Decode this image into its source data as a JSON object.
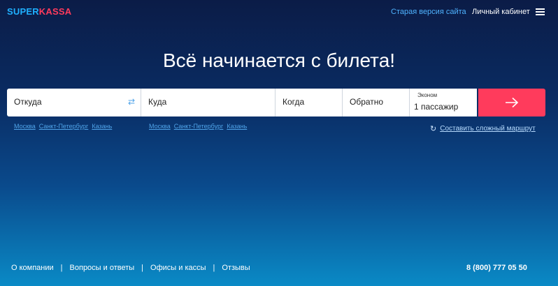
{
  "header": {
    "logo_part1": "SUPER",
    "logo_part2": "KASSA",
    "old_site_link": "Старая версия сайта",
    "cabinet_link": "Личный кабинет",
    "menu_icon": "hamburger-menu-icon"
  },
  "headline": "Всё начинается с билета!",
  "search": {
    "from_placeholder": "Откуда",
    "to_placeholder": "Куда",
    "when_placeholder": "Когда",
    "back_placeholder": "Обратно",
    "class_label": "Эконом",
    "passengers": "1 пассажир",
    "swap_icon": "swap-arrows-icon",
    "submit_icon": "arrow-right-icon",
    "submit_color": "#ff3b5c"
  },
  "quick_from": [
    "Москва",
    "Санкт-Петербург",
    "Казань"
  ],
  "quick_to": [
    "Москва",
    "Санкт-Петербург",
    "Казань"
  ],
  "complex_route": "Составить сложный маршрут",
  "footer": {
    "links": [
      "О компании",
      "Вопросы и ответы",
      "Офисы и кассы",
      "Отзывы"
    ],
    "separator": "|",
    "phone": "8 (800) 777 05 50"
  }
}
